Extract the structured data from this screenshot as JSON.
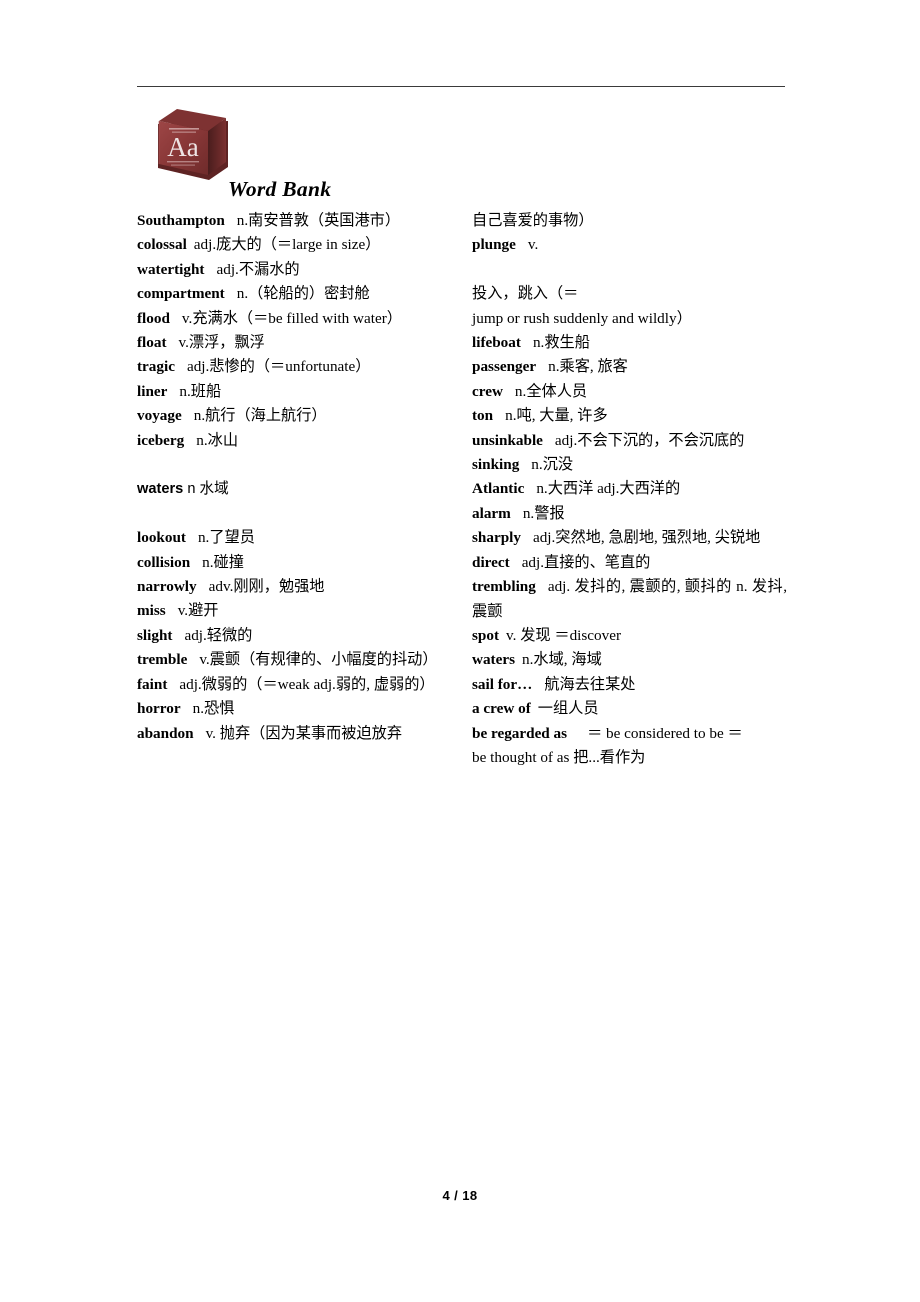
{
  "document": {
    "section_title": "Word Bank",
    "book_icon_letters": "Aa",
    "book_icon_color": "#8e3a3a",
    "rule_color": "#3a3a3a",
    "footer": "4 / 18"
  },
  "left_column": {
    "entries": [
      {
        "headword": "Southampton",
        "definition": "n.南安普敦（英国港市）",
        "gap": "gap-m"
      },
      {
        "headword": "colossal",
        "definition": "adj.庞大的（＝large in size）",
        "gap": "gap-s"
      },
      {
        "headword": "watertight",
        "definition": "adj.不漏水的",
        "gap": "gap-m"
      },
      {
        "headword": "compartment",
        "definition": "n.（轮船的）密封舱",
        "gap": "gap-m"
      },
      {
        "headword": "flood",
        "definition": "v.充满水（＝be filled with water）",
        "gap": "gap-m"
      },
      {
        "headword": "float",
        "definition": "v.漂浮，飘浮",
        "gap": "gap-m"
      },
      {
        "headword": "tragic",
        "definition": "adj.悲惨的（＝unfortunate）",
        "gap": "gap-m"
      },
      {
        "headword": "liner",
        "definition": "n.班船",
        "gap": "gap-m"
      },
      {
        "headword": "voyage",
        "definition": "n.航行（海上航行）",
        "gap": "gap-m"
      },
      {
        "headword": "iceberg",
        "definition": "n.冰山",
        "gap": "gap-m"
      }
    ],
    "sans_entry": {
      "headword": "waters",
      "definition": "n 水域"
    },
    "entries2": [
      {
        "headword": "lookout",
        "definition": "n.了望员",
        "gap": "gap-m"
      },
      {
        "headword": "collision",
        "definition": "n.碰撞",
        "gap": "gap-m"
      },
      {
        "headword": "narrowly",
        "definition": "adv.刚刚，勉强地",
        "gap": "gap-m"
      },
      {
        "headword": "miss",
        "definition": "v.避开",
        "gap": "gap-m"
      },
      {
        "headword": "slight",
        "definition": "adj.轻微的",
        "gap": "gap-m"
      },
      {
        "headword": "tremble",
        "definition": "v.震颤（有规律的、小幅度的抖动）",
        "gap": "gap-m"
      },
      {
        "headword": "faint",
        "definition": "adj.微弱的（＝weak    adj.弱的, 虚弱的）",
        "gap": "gap-m"
      },
      {
        "headword": "horror",
        "definition": "n.恐惧",
        "gap": "gap-m"
      },
      {
        "headword": "abandon",
        "definition": "v. 抛弃（因为某事而被迫放弃",
        "gap": "gap-m"
      }
    ]
  },
  "right_column": {
    "continuation_line": "自己喜爱的事物）",
    "plunge": {
      "headword": "plunge",
      "pos": "v.",
      "definition": "投入，跳入（＝",
      "wrap": "jump or rush suddenly and wildly）"
    },
    "entries": [
      {
        "headword": "lifeboat",
        "definition": "n.救生船",
        "gap": "gap-m"
      },
      {
        "headword": "passenger",
        "definition": "n.乘客, 旅客",
        "gap": "gap-m"
      },
      {
        "headword": "crew",
        "definition": "n.全体人员",
        "gap": "gap-m"
      },
      {
        "headword": "ton",
        "definition": "n.吨, 大量, 许多",
        "gap": "gap-m"
      },
      {
        "headword": "unsinkable",
        "definition": "adj.不会下沉的，不会沉底的",
        "gap": "gap-m"
      },
      {
        "headword": "sinking",
        "definition": "n.沉没",
        "gap": "gap-m"
      },
      {
        "headword": "Atlantic",
        "definition": "n.大西洋 adj.大西洋的",
        "gap": "gap-m"
      },
      {
        "headword": "alarm",
        "definition": "n.警报",
        "gap": "gap-m"
      },
      {
        "headword": "sharply",
        "definition": "adj.突然地, 急剧地, 强烈地, 尖锐地",
        "gap": "gap-m"
      },
      {
        "headword": "direct",
        "definition": "adj.直接的、笔直的",
        "gap": "gap-m"
      },
      {
        "headword": "trembling",
        "definition": "adj. 发抖的, 震颤的, 颤抖的  n. 发抖, 震颤",
        "gap": "gap-m"
      },
      {
        "headword": "spot",
        "definition": "v. 发现 ＝discover",
        "gap": "gap-s"
      },
      {
        "headword": "waters",
        "definition": "n.水域, 海域",
        "gap": "gap-s"
      },
      {
        "headword": "sail for…",
        "definition": "航海去往某处",
        "gap": "gap-m"
      },
      {
        "headword": "a crew of",
        "definition": "一组人员",
        "gap": "gap-s"
      }
    ],
    "regarded": {
      "headword": "be regarded as",
      "definition": "＝    be considered to be    ＝",
      "wrap": "be thought of as    把...看作为"
    }
  }
}
